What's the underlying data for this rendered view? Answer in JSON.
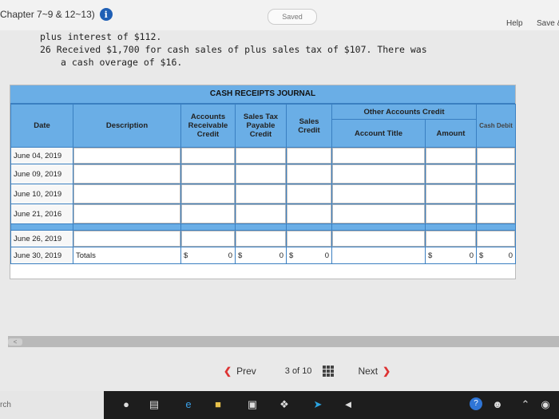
{
  "header": {
    "chapter": "Chapter 7~9 & 12~13)",
    "saved": "Saved",
    "help": "Help",
    "save": "Save &"
  },
  "problem": {
    "line1": "plus interest of $112.",
    "line2": "26 Received $1,700 for cash sales of plus sales tax of $107. There was",
    "line3": "a cash overage of $16."
  },
  "journal": {
    "title": "CASH RECEIPTS JOURNAL",
    "other_group": "Other Accounts Credit",
    "headers": {
      "date": "Date",
      "description": "Description",
      "ar": "Accounts Receivable Credit",
      "stp": "Sales Tax Payable Credit",
      "sales": "Sales Credit",
      "account_title": "Account Title",
      "amount": "Amount",
      "cash": "Cash Debit"
    },
    "rows": [
      {
        "date": "June 04, 2019"
      },
      {
        "date": "June 09, 2019"
      },
      {
        "date": "June 10, 2019"
      },
      {
        "date": "June 21, 2016"
      },
      {
        "date": "June 26, 2019"
      }
    ],
    "totals": {
      "date": "June 30, 2019",
      "label": "Totals",
      "ar_sym": "$",
      "ar_val": "0",
      "stp_sym": "$",
      "stp_val": "0",
      "sales_sym": "$",
      "sales_val": "0",
      "amount_sym": "$",
      "amount_val": "0",
      "cash_sym": "$",
      "cash_val": "0"
    }
  },
  "pager": {
    "prev": "Prev",
    "current": "3",
    "of": "of",
    "total": "10",
    "next": "Next"
  },
  "taskbar": {
    "search": "rch"
  }
}
